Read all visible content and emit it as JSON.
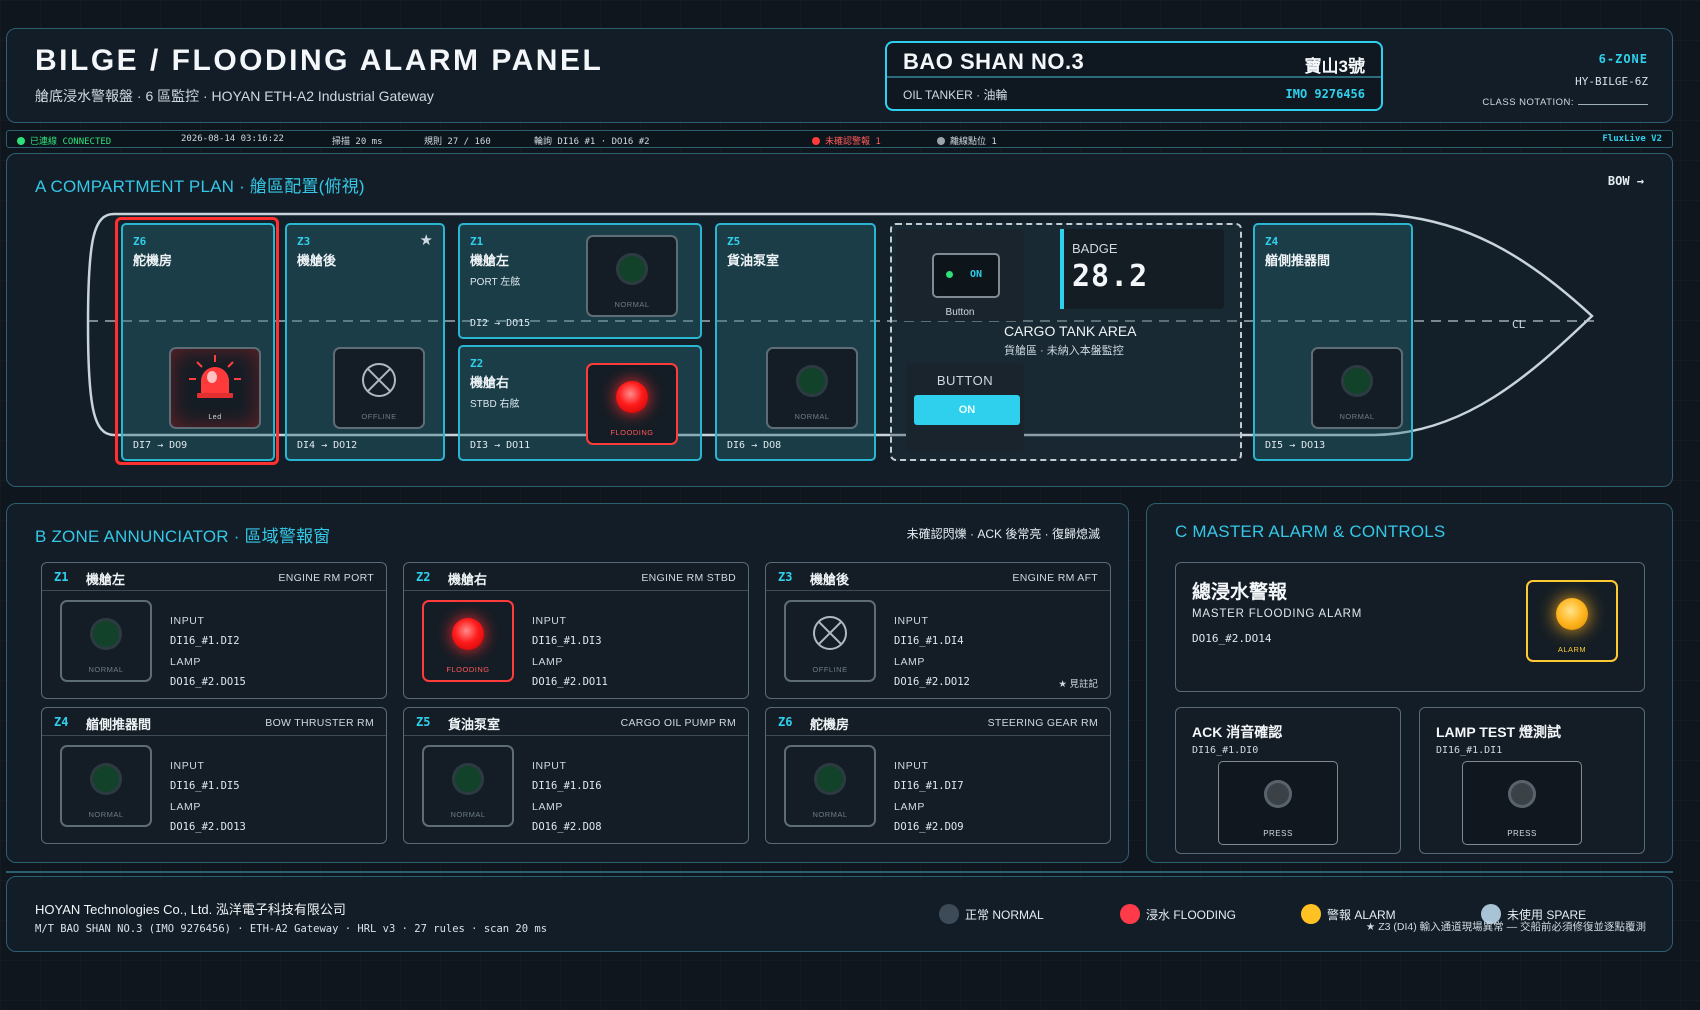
{
  "header": {
    "title": "BILGE / FLOODING ALARM PANEL",
    "subtitle": "艙底浸水警報盤 · 6 區監控 · HOYAN ETH-A2 Industrial Gateway",
    "ship_name": "BAO SHAN NO.3",
    "ship_name_cn": "寶山3號",
    "ship_type": "OIL TANKER · 油輪",
    "imo": "IMO 9276456",
    "zone_count": "6-ZONE",
    "panel_id": "HY-BILGE-6Z",
    "class_notation_label": "CLASS NOTATION:"
  },
  "status_bar": {
    "connection": "已連線",
    "connection_en": "CONNECTED",
    "timestamp": "2026-08-14 03:16:22",
    "scan": "掃描 20 ms",
    "rules": "規則 27 / 160",
    "polling": "輪詢 DI16 #1 · DO16 #2",
    "unack": "未確認警報 1",
    "offline": "離線點位 1",
    "version": "FluxLive V2",
    "colors": {
      "connected": "#2ee07a",
      "unack": "#ff3b3b",
      "offline": "#9aa4ab"
    }
  },
  "plan": {
    "title": "A COMPARTMENT PLAN · 艙區配置(俯視)",
    "bow_label": "BOW →",
    "centerline_label": "CL",
    "zones": [
      {
        "id": "Z6",
        "name": "舵機房",
        "sub": "",
        "io": "DI7 → DO9",
        "state": "alarm",
        "lamp_label": "Led"
      },
      {
        "id": "Z3",
        "name": "機艙後",
        "sub": "",
        "io": "DI4 → DO12",
        "state": "offline",
        "lamp_label": "OFFLINE",
        "star": "★"
      },
      {
        "id": "Z1",
        "name": "機艙左",
        "sub": "PORT 左舷",
        "io": "DI2 → DO15",
        "state": "normal",
        "lamp_label": "NORMAL"
      },
      {
        "id": "Z2",
        "name": "機艙右",
        "sub": "STBD 右舷",
        "io": "DI3 → DO11",
        "state": "flooding",
        "lamp_label": "FLOODING"
      },
      {
        "id": "Z5",
        "name": "貨油泵室",
        "sub": "",
        "io": "DI6 → DO8",
        "state": "normal",
        "lamp_label": "NORMAL"
      },
      {
        "id": "Z4",
        "name": "艏側推器間",
        "sub": "",
        "io": "DI5 → DO13",
        "state": "normal",
        "lamp_label": "NORMAL"
      }
    ],
    "cargo": {
      "toggle_state": "ON",
      "toggle_caption": "Button",
      "badge_label": "BADGE",
      "badge_value": "28.2",
      "title": "CARGO TANK AREA",
      "subtitle": "貨艙區 · 未納入本盤監控",
      "button_label": "BUTTON",
      "button_state": "ON"
    }
  },
  "annunciator": {
    "title": "B ZONE ANNUNCIATOR · 區域警報窗",
    "note": "未確認閃爍 · ACK 後常亮 · 復歸熄滅",
    "input_label": "INPUT",
    "lamp_label": "LAMP",
    "cards": [
      {
        "id": "Z1",
        "name": "機艙左",
        "en": "ENGINE RM PORT",
        "input": "DI16_#1.DI2",
        "lamp": "DO16_#2.DO15",
        "state": "normal",
        "lamp_text": "NORMAL",
        "note": ""
      },
      {
        "id": "Z2",
        "name": "機艙右",
        "en": "ENGINE RM STBD",
        "input": "DI16_#1.DI3",
        "lamp": "DO16_#2.DO11",
        "state": "flooding",
        "lamp_text": "FLOODING",
        "note": ""
      },
      {
        "id": "Z3",
        "name": "機艙後",
        "en": "ENGINE RM AFT",
        "input": "DI16_#1.DI4",
        "lamp": "DO16_#2.DO12",
        "state": "offline",
        "lamp_text": "OFFLINE",
        "note": "★ 見註記"
      },
      {
        "id": "Z4",
        "name": "艏側推器間",
        "en": "BOW THRUSTER RM",
        "input": "DI16_#1.DI5",
        "lamp": "DO16_#2.DO13",
        "state": "normal",
        "lamp_text": "NORMAL",
        "note": ""
      },
      {
        "id": "Z5",
        "name": "貨油泵室",
        "en": "CARGO OIL PUMP RM",
        "input": "DI16_#1.DI6",
        "lamp": "DO16_#2.DO8",
        "state": "normal",
        "lamp_text": "NORMAL",
        "note": ""
      },
      {
        "id": "Z6",
        "name": "舵機房",
        "en": "STEERING GEAR RM",
        "input": "DI16_#1.DI7",
        "lamp": "DO16_#2.DO9",
        "state": "normal",
        "lamp_text": "NORMAL",
        "note": ""
      }
    ]
  },
  "master": {
    "title": "C MASTER ALARM & CONTROLS",
    "alarm_title": "總浸水警報",
    "alarm_sub": "MASTER FLOODING ALARM",
    "alarm_io": "DO16_#2.DO14",
    "alarm_lamp_text": "ALARM",
    "ack_title": "ACK 消音確認",
    "ack_io": "DI16_#1.DI0",
    "ack_btn": "PRESS",
    "test_title": "LAMP TEST 燈測試",
    "test_io": "DI16_#1.DI1",
    "test_btn": "PRESS"
  },
  "footer": {
    "company": "HOYAN Technologies Co., Ltd. 泓洋電子科技有限公司",
    "meta": "M/T BAO SHAN NO.3 (IMO 9276456) · ETH-A2 Gateway · HRL v3 · 27 rules · scan 20 ms",
    "legend": [
      {
        "label": "正常 NORMAL",
        "color": "#3d4a57"
      },
      {
        "label": "浸水 FLOODING",
        "color": "#ff3b4a"
      },
      {
        "label": "警報 ALARM",
        "color": "#ffc222"
      },
      {
        "label": "未使用 SPARE",
        "color": "#a9c3d6"
      }
    ],
    "note": "★ Z3 (DI4) 輸入通道現場異常 — 交船前必須修復並逐點覆測"
  }
}
